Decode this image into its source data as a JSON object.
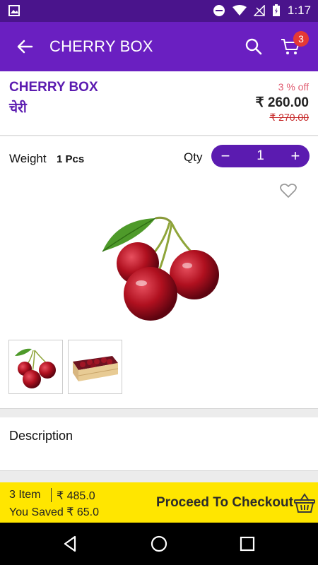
{
  "status_bar": {
    "time": "1:17"
  },
  "app_bar": {
    "title": "CHERRY BOX",
    "cart_count": "3"
  },
  "product": {
    "name": "CHERRY BOX",
    "name_hindi": "चेरी",
    "discount": "3 % off",
    "price": "₹ 260.00",
    "mrp": "₹ 270.00"
  },
  "details": {
    "weight_label": "Weight",
    "weight_value": "1 Pcs",
    "qty_label": "Qty",
    "qty_value": "1",
    "minus": "−",
    "plus": "+"
  },
  "description": {
    "label": "Description"
  },
  "checkout": {
    "items": "3 Item",
    "total": "₹ 485.0",
    "saved": "You Saved ₹ 65.0",
    "button_label": "Proceed To Checkout"
  },
  "icons": {
    "back": "arrow-back-icon",
    "search": "search-icon",
    "cart": "cart-icon",
    "favorite": "heart-outline-icon",
    "basket": "basket-icon"
  },
  "colors": {
    "status_bar": "#4a148c",
    "app_bar": "#6a1fc1",
    "accent": "#5b1bb0",
    "checkout_bar": "#ffe600",
    "badge": "#e53935"
  }
}
